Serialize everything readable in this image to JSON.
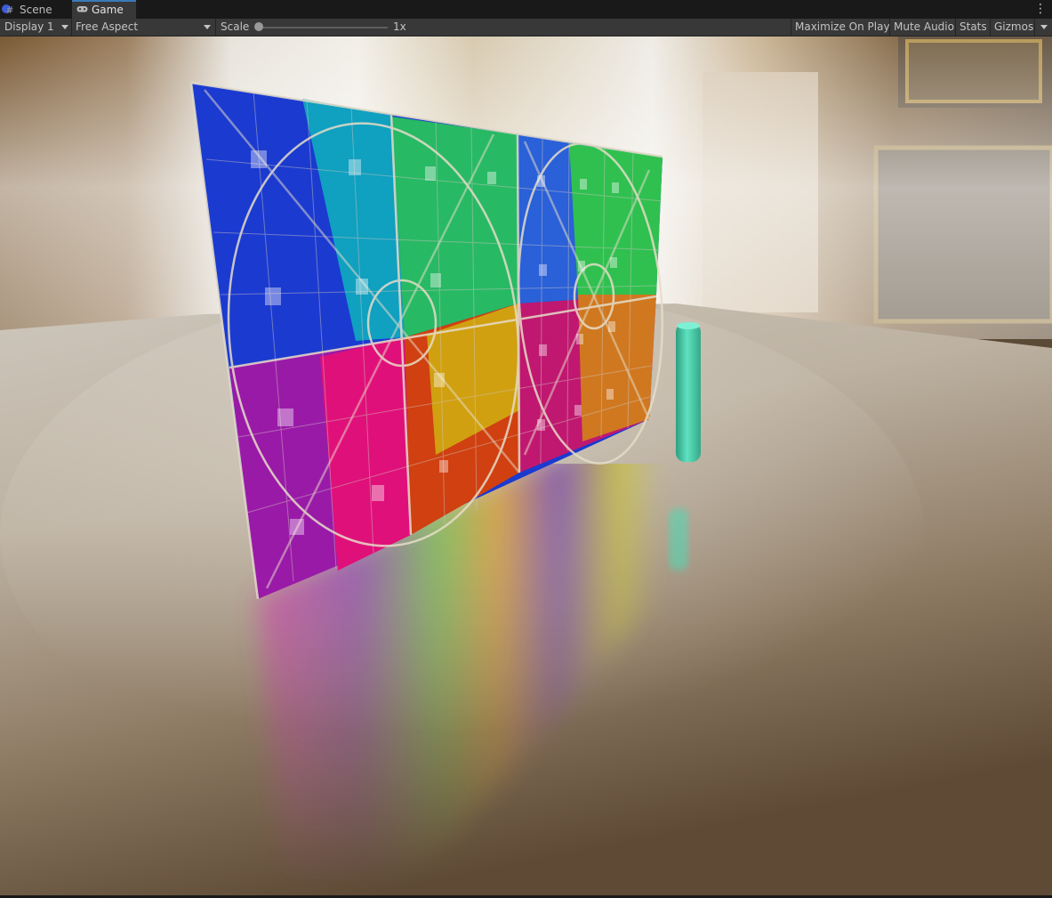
{
  "tabs": {
    "scene": "Scene",
    "game": "Game"
  },
  "toolbar": {
    "display": "Display 1",
    "aspect": "Free Aspect",
    "scale_label": "Scale",
    "scale_value": "1x",
    "maximize_on_play": "Maximize On Play",
    "mute_audio": "Mute Audio",
    "stats": "Stats",
    "gizmos": "Gizmos"
  },
  "icons": {
    "scene_tab": "grid-icon",
    "game_tab": "gamepad-icon",
    "more": "kebab-menu-icon"
  },
  "colors": {
    "accent": "#3a79bb",
    "toolbar_bg": "#383838",
    "tabbar_bg": "#191919",
    "cylinder": "#4fd6b0"
  }
}
